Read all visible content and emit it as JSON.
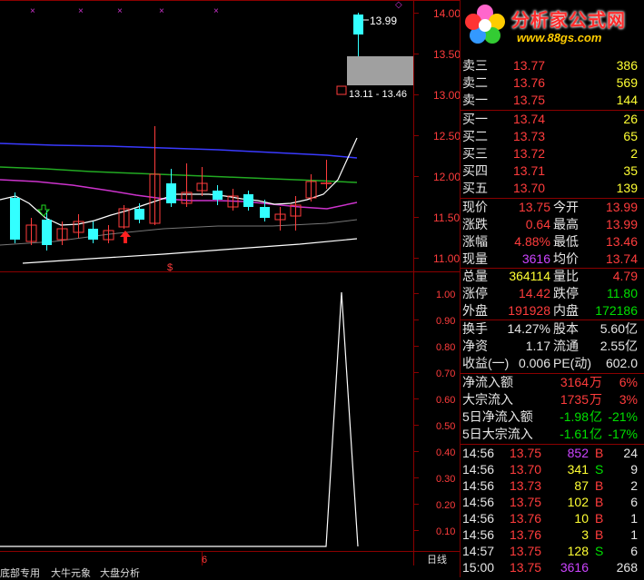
{
  "price_axis": {
    "ticks": [
      "14.00",
      "13.50",
      "13.00",
      "12.50",
      "12.00",
      "11.50",
      "11.00"
    ]
  },
  "price_tags": {
    "high": "13.99",
    "range": "13.11 - 13.46"
  },
  "indicator_axis": {
    "ticks": [
      "1.00",
      "0.90",
      "0.80",
      "0.70",
      "0.60",
      "0.50",
      "0.40",
      "0.30",
      "0.20",
      "0.10"
    ]
  },
  "x_axis": {
    "mark": "6"
  },
  "period": "日线",
  "bottom_tabs": [
    "底部专用",
    "大牛元象",
    "大盘分析"
  ],
  "brand": {
    "name": "分析家公式网",
    "url": "www.88gs.com"
  },
  "order_book": {
    "asks": [
      {
        "label": "卖三",
        "price": "13.77",
        "vol": "386"
      },
      {
        "label": "卖二",
        "price": "13.76",
        "vol": "569"
      },
      {
        "label": "卖一",
        "price": "13.75",
        "vol": "144"
      }
    ],
    "bids": [
      {
        "label": "买一",
        "price": "13.74",
        "vol": "26"
      },
      {
        "label": "买二",
        "price": "13.73",
        "vol": "65"
      },
      {
        "label": "买三",
        "price": "13.72",
        "vol": "2"
      },
      {
        "label": "买四",
        "price": "13.71",
        "vol": "35"
      },
      {
        "label": "买五",
        "price": "13.70",
        "vol": "139"
      }
    ]
  },
  "quote": [
    {
      "l1": "现价",
      "v1": "13.75",
      "l2": "今开",
      "v2": "13.99"
    },
    {
      "l1": "涨跌",
      "v1": "0.64",
      "l2": "最高",
      "v2": "13.99"
    },
    {
      "l1": "涨幅",
      "v1": "4.88%",
      "l2": "最低",
      "v2": "13.46"
    },
    {
      "l1": "现量",
      "v1": "3616",
      "l2": "均价",
      "v2": "13.74"
    },
    {
      "l1": "总量",
      "v1": "364114",
      "l2": "量比",
      "v2": "4.79"
    },
    {
      "l1": "涨停",
      "v1": "14.42",
      "l2": "跌停",
      "v2": "11.80"
    },
    {
      "l1": "外盘",
      "v1": "191928",
      "l2": "内盘",
      "v2": "172186"
    }
  ],
  "fundamentals": [
    {
      "l1": "换手",
      "v1": "14.27%",
      "l2": "股本",
      "v2": "5.60亿"
    },
    {
      "l1": "净资",
      "v1": "1.17",
      "l2": "流通",
      "v2": "2.55亿"
    },
    {
      "l1": "收益(一)",
      "v1": "0.006",
      "l2": "PE(动)",
      "v2": "602.0"
    }
  ],
  "flows": [
    {
      "label": "净流入额",
      "value": "3164",
      "unit": "万",
      "pct": "6%"
    },
    {
      "label": "大宗流入",
      "value": "1735",
      "unit": "万",
      "pct": "3%"
    },
    {
      "label": "5日净流入额",
      "value": "-1.98",
      "unit": "亿",
      "pct": "-21%"
    },
    {
      "label": "5日大宗流入",
      "value": "-1.61",
      "unit": "亿",
      "pct": "-17%"
    }
  ],
  "ticks": [
    {
      "time": "14:56",
      "price": "13.75",
      "vol": "852",
      "side": "B",
      "n": "24"
    },
    {
      "time": "14:56",
      "price": "13.70",
      "vol": "341",
      "side": "S",
      "n": "9"
    },
    {
      "time": "14:56",
      "price": "13.73",
      "vol": "87",
      "side": "B",
      "n": "2"
    },
    {
      "time": "14:56",
      "price": "13.75",
      "vol": "102",
      "side": "B",
      "n": "6"
    },
    {
      "time": "14:56",
      "price": "13.76",
      "vol": "10",
      "side": "B",
      "n": "1"
    },
    {
      "time": "14:56",
      "price": "13.76",
      "vol": "3",
      "side": "B",
      "n": "1"
    },
    {
      "time": "14:57",
      "price": "13.75",
      "vol": "128",
      "side": "S",
      "n": "6"
    },
    {
      "time": "15:00",
      "price": "13.75",
      "vol": "3616",
      "side": "",
      "n": "268"
    }
  ],
  "colors": {
    "up": "#ff3c3c",
    "down": "#00e000",
    "cyan": "#33ffff",
    "ma_blue": "#3a3aff",
    "ma_green": "#22aa22",
    "ma_purple": "#cc33cc",
    "ma_white": "#ffffff",
    "grid": "#8b0000"
  }
}
